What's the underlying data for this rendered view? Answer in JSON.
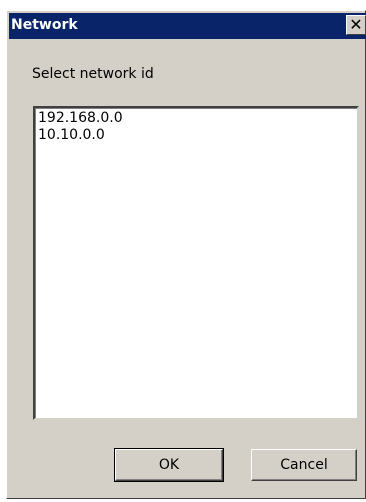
{
  "window": {
    "title": "Network",
    "close_glyph": "✕"
  },
  "prompt": "Select network id",
  "network_list": {
    "items": [
      "192.168.0.0",
      "10.10.0.0"
    ]
  },
  "buttons": {
    "ok_label": "OK",
    "cancel_label": "Cancel"
  },
  "colors": {
    "titlebar": "#0a246a",
    "dialog_face": "#d4d0c8",
    "list_background": "#ffffff"
  }
}
